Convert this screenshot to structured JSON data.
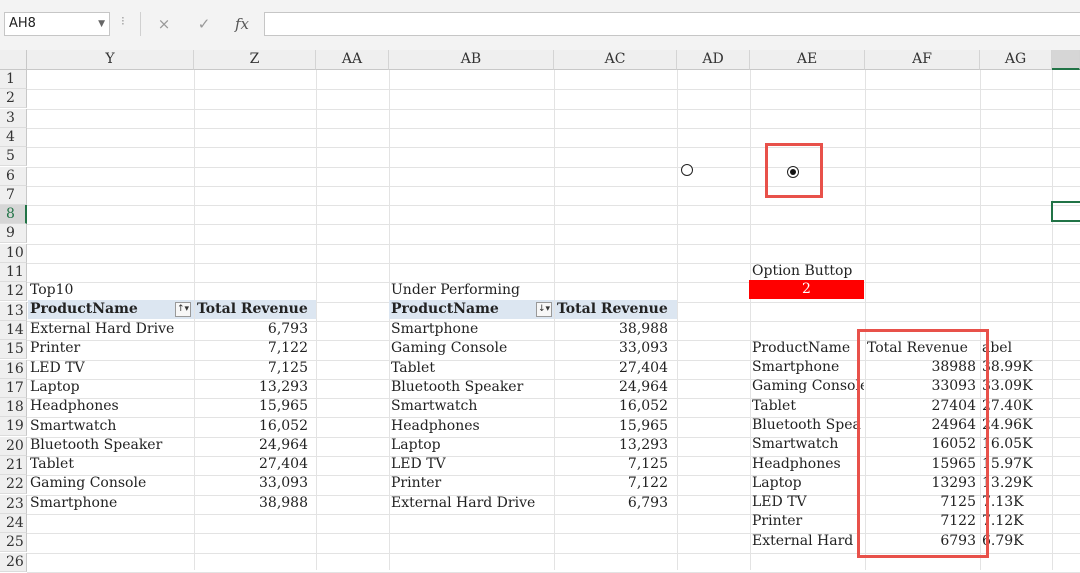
{
  "formula_bar": {
    "name_box": "AH8",
    "cancel_icon": "×",
    "enter_icon": "✓",
    "fx_label": "fx",
    "formula": ""
  },
  "columns": [
    "Y",
    "Z",
    "AA",
    "AB",
    "AC",
    "AD",
    "AE",
    "AF",
    "AG"
  ],
  "rows": [
    "1",
    "2",
    "3",
    "4",
    "5",
    "6",
    "7",
    "8",
    "9",
    "10",
    "11",
    "12",
    "13",
    "14",
    "15",
    "16",
    "17",
    "18",
    "19",
    "20",
    "21",
    "22",
    "23",
    "24",
    "25",
    "26"
  ],
  "top10": {
    "title": "Top10",
    "headers": [
      "ProductName",
      "Total Revenue"
    ],
    "rows": [
      [
        "External Hard Drive",
        "6,793"
      ],
      [
        "Printer",
        "7,122"
      ],
      [
        "LED TV",
        "7,125"
      ],
      [
        "Laptop",
        "13,293"
      ],
      [
        "Headphones",
        "15,965"
      ],
      [
        "Smartwatch",
        "16,052"
      ],
      [
        "Bluetooth Speaker",
        "24,964"
      ],
      [
        "Tablet",
        "27,404"
      ],
      [
        "Gaming Console",
        "33,093"
      ],
      [
        "Smartphone",
        "38,988"
      ]
    ]
  },
  "under": {
    "title": "Under Performing",
    "headers": [
      "ProductName",
      "Total Revenue"
    ],
    "rows": [
      [
        "Smartphone",
        "38,988"
      ],
      [
        "Gaming Console",
        "33,093"
      ],
      [
        "Tablet",
        "27,404"
      ],
      [
        "Bluetooth Speaker",
        "24,964"
      ],
      [
        "Smartwatch",
        "16,052"
      ],
      [
        "Headphones",
        "15,965"
      ],
      [
        "Laptop",
        "13,293"
      ],
      [
        "LED TV",
        "7,125"
      ],
      [
        "Printer",
        "7,122"
      ],
      [
        "External Hard Drive",
        "6,793"
      ]
    ]
  },
  "option": {
    "label": "Option Buttop",
    "value": "2",
    "selected_index": 2
  },
  "result": {
    "headers": [
      "ProductName",
      "Total Revenue",
      "Label"
    ],
    "header_label_visible": "abel",
    "rows": [
      [
        "Smartphone",
        "38988",
        "38.99K"
      ],
      [
        "Gaming Console",
        "33093",
        "33.09K"
      ],
      [
        "Tablet",
        "27404",
        "27.40K"
      ],
      [
        "Bluetooth Spea",
        "24964",
        "24.96K"
      ],
      [
        "Smartwatch",
        "16052",
        "16.05K"
      ],
      [
        "Headphones",
        "15965",
        "15.97K"
      ],
      [
        "Laptop",
        "13293",
        "13.29K"
      ],
      [
        "LED TV",
        "7125",
        "7.13K"
      ],
      [
        "Printer",
        "7122",
        "7.12K"
      ],
      [
        "External Hard",
        "6793",
        "6.79K"
      ]
    ]
  },
  "colors": {
    "accent_red": "#ff0000",
    "highlight_box": "#e8514a",
    "table_header_fill": "#dce6f1",
    "selection": "#217346"
  }
}
